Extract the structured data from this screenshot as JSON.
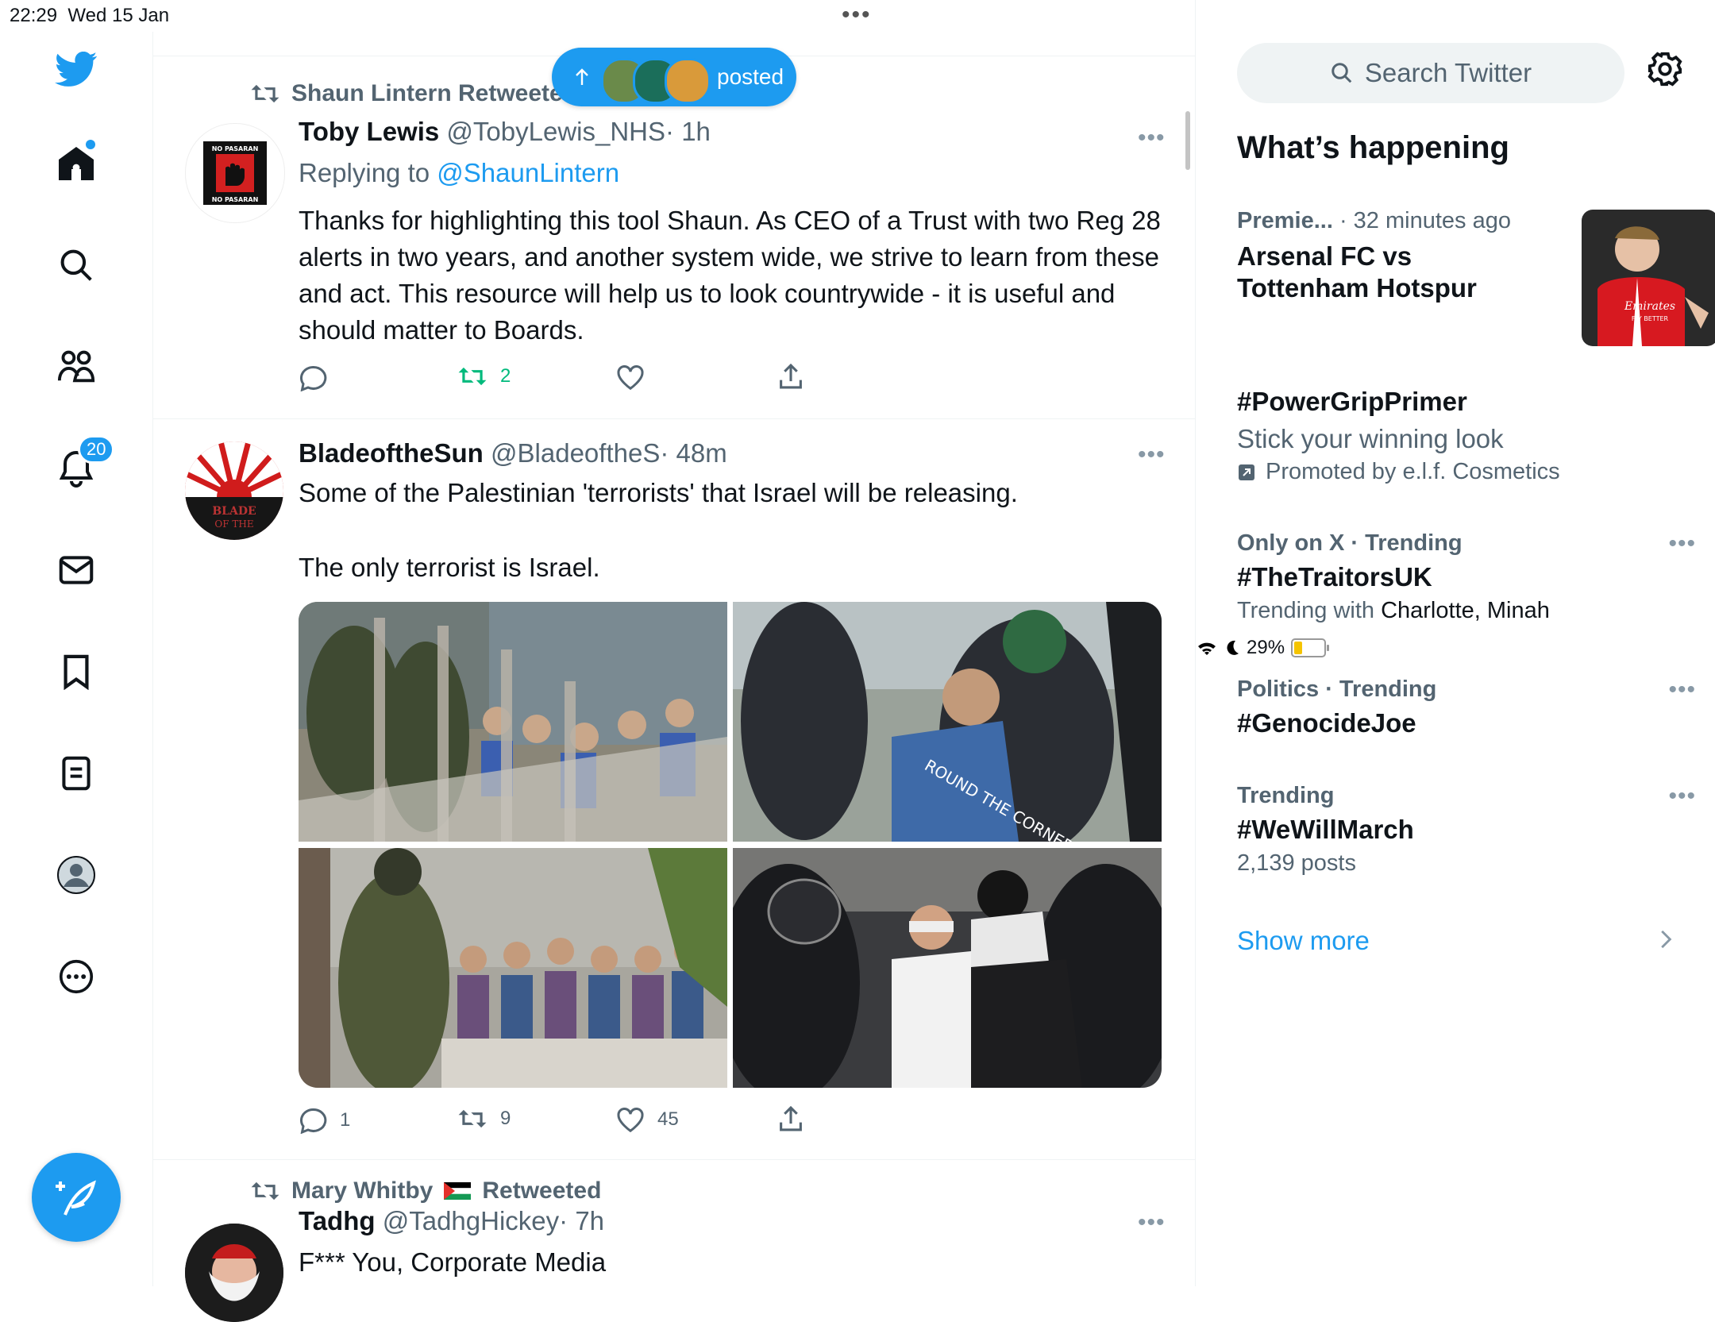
{
  "status_bar": {
    "time": "22:29",
    "date": "Wed 15 Jan",
    "battery": "29%",
    "battery_level": 0.29
  },
  "nav": {
    "notifications_badge": "20"
  },
  "new_posts_pill": {
    "label": "posted"
  },
  "tweets": [
    {
      "retweeted_by": "Shaun Lintern Retweeted",
      "name": "Toby Lewis",
      "handle": "@TobyLewis_NHS",
      "time": "· 1h",
      "replying_prefix": "Replying to ",
      "replying_to": "@ShaunLintern",
      "text": "Thanks for highlighting this tool Shaun.  As CEO of a Trust with two Reg 28 alerts in two years, and another system wide, we strive to learn from these and act.  This resource will help us to look countrywide - it is useful and should matter to Boards.",
      "replies": "",
      "retweets": "2",
      "likes": "",
      "avatar_text_top": "NO PASARAN",
      "avatar_text_bottom": "NO PASARAN"
    },
    {
      "name": "BladeoftheSun",
      "handle": "@BladeoftheS",
      "time": "· 48m",
      "text_line1": "Some of the Palestinian 'terrorists' that Israel will be releasing.",
      "text_line2": "The only terrorist is Israel.",
      "replies": "1",
      "retweets": "9",
      "likes": "45",
      "avatar_text": "BLADE OF THE"
    },
    {
      "retweeted_by_name": "Mary Whitby",
      "retweeted_by_suffix": "Retweeted",
      "name": "Tadhg",
      "handle": "@TadhgHickey",
      "time": "· 7h",
      "text": "F*** You, Corporate Media"
    }
  ],
  "sidebar": {
    "search_placeholder": "Search Twitter",
    "section_title": "What’s happening",
    "trends": [
      {
        "category": "Premie...",
        "meta": "· 32 minutes ago",
        "title_line1": "Arsenal FC vs",
        "title_line2": "Tottenham Hotspur",
        "image_text": "Emirates FLY BETTER"
      },
      {
        "title": "#PowerGripPrimer",
        "sub": "Stick your winning look",
        "promoted": "Promoted by e.l.f. Cosmetics"
      },
      {
        "meta": "Only on X · Trending",
        "title": "#TheTraitorsUK",
        "sub_prefix": "Trending with ",
        "sub_names": "Charlotte, Minah"
      },
      {
        "meta": "Politics · Trending",
        "title": "#GenocideJoe"
      },
      {
        "meta": "Trending",
        "title": "#WeWillMarch",
        "sub": "2,139 posts"
      }
    ],
    "show_more": "Show more"
  },
  "colors": {
    "accent": "#1d9bf0",
    "retweet_green": "#00ba7c",
    "muted": "#536471"
  }
}
